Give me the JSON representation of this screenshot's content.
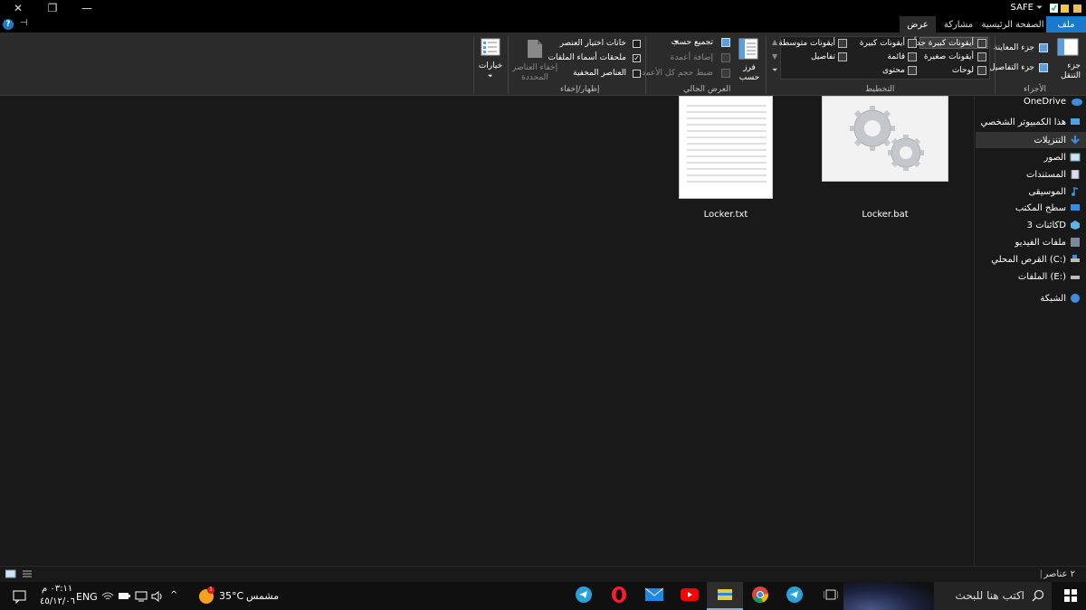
{
  "window": {
    "title": "SAFE",
    "controls": {
      "close": "✕",
      "maximize": "❐",
      "minimize": "—"
    }
  },
  "tabs": {
    "file": "ملف",
    "home": "الصفحة الرئيسية",
    "share": "مشاركة",
    "view": "عرض"
  },
  "ribbon": {
    "panes": {
      "nav_pane": "جزء التنقل",
      "preview_pane": "جزء المعاينة",
      "details_pane": "جزء التفاصيل",
      "group_label": "الأجزاء"
    },
    "layout": {
      "extra_large": "أيقونات كبيرة جداً",
      "large": "أيقونات كبيرة",
      "medium": "أيقونات متوسطة",
      "small": "أيقونات صغيرة",
      "list": "قائمة",
      "details": "تفاصيل",
      "tiles": "لوحات",
      "content": "محتوى",
      "group_label": "التخطيط"
    },
    "current_view": {
      "sort_by": "فرز حسب",
      "group_by": "تجميع حسب",
      "add_columns": "إضافة أعمدة",
      "size_columns": "ضبط حجم كل الأعمدة",
      "group_label": "العرض الحالي"
    },
    "show_hide": {
      "item_checkboxes": "خانات اختيار العنصر",
      "file_extensions": "ملحقات أسماء الملفات",
      "hidden_items": "العناصر المخفية",
      "hide_selected_line1": "إخفاء العناصر",
      "hide_selected_line2": "المحددة",
      "group_label": "إظهار/إخفاء"
    },
    "options": "خيارات"
  },
  "nav": {
    "items": [
      {
        "label": "OneDrive",
        "icon": "cloud-icon"
      },
      {
        "label": "هذا الكمبيوتر الشخصي",
        "icon": "computer-icon"
      },
      {
        "label": "التنزيلات",
        "icon": "download-icon"
      },
      {
        "label": "الصور",
        "icon": "pictures-icon"
      },
      {
        "label": "المستندات",
        "icon": "documents-icon"
      },
      {
        "label": "الموسيقى",
        "icon": "music-icon"
      },
      {
        "label": "سطح المكتب",
        "icon": "desktop-icon"
      },
      {
        "label": "كائنات ثلاثية الأبعاد",
        "label_display": "كائنات 3D",
        "icon": "3d-objects-icon"
      },
      {
        "label": "ملفات الفيديو",
        "icon": "videos-icon"
      },
      {
        "label": "القرص المحلي (C:)",
        "icon": "drive-icon"
      },
      {
        "label": "الملفات (E:)",
        "icon": "drive-icon"
      },
      {
        "label": "الشبكة",
        "icon": "network-icon"
      }
    ]
  },
  "files": [
    {
      "name": "Locker.bat",
      "icon": "batch-file-icon"
    },
    {
      "name": "Locker.txt",
      "icon": "text-file-icon"
    }
  ],
  "status": {
    "items": "٢ عناصر"
  },
  "taskbar": {
    "search_placeholder": "اكتب هنا للبحث",
    "weather_temp": "35°C",
    "weather_desc": "مشمس",
    "weather_badge": "1",
    "lang": "ENG",
    "time": "٠٣:١١ م",
    "date": "٤٥/١٢/٠٦"
  },
  "colors": {
    "accent": "#1979ca",
    "background": "#191919",
    "ribbon": "#2b2b2b"
  }
}
